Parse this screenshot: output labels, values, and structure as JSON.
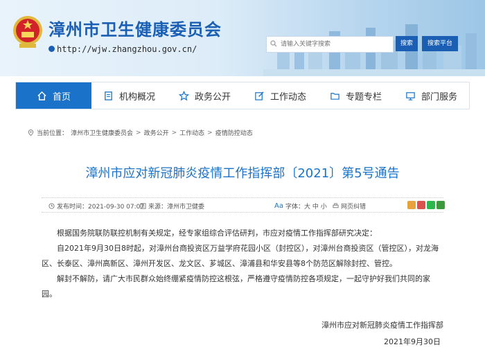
{
  "site": {
    "title": "漳州市卫生健康委员会",
    "url": "http://wjw.zhangzhou.gov.cn/"
  },
  "search": {
    "placeholder": "请输入关键字搜索",
    "search_label": "搜索",
    "platform_label": "搜索平台"
  },
  "nav": [
    {
      "label": "首页",
      "icon": "home-icon"
    },
    {
      "label": "机构概况",
      "icon": "document-icon"
    },
    {
      "label": "政务公开",
      "icon": "star-icon"
    },
    {
      "label": "工作动态",
      "icon": "edit-icon"
    },
    {
      "label": "专题专栏",
      "icon": "folder-icon"
    },
    {
      "label": "部门服务",
      "icon": "monitor-icon"
    }
  ],
  "breadcrumb": {
    "prefix": "当前位置：",
    "items": [
      "漳州市卫生健康委员会",
      "政务公开",
      "工作动态",
      "疫情防控动态"
    ]
  },
  "article": {
    "title": "漳州市应对新冠肺炎疫情工作指挥部〔2021〕第5号通告",
    "publish_time": "发布时间：2021-09-30 07:07",
    "source": "来源：漳州市卫健委",
    "font_size": "字体：大 中 小",
    "print": "网页纠错",
    "paragraphs": [
      "根据国务院联防联控机制有关规定，经专家组综合评估研判，市应对疫情工作指挥部研究决定：",
      "自2021年9月30日8时起，对漳州台商投资区万益学府花园小区（封控区），对漳州台商投资区（管控区），对龙海区、长泰区、漳州高新区、漳州开发区、龙文区、芗城区、漳浦县和华安县等8个防范区解除封控、管控。",
      "解封不解防，请广大市民群众始终绷紧疫情防控这根弦，严格遵守疫情防控各项规定，一起守护好我们共同的家园。"
    ],
    "signature": "漳州市应对新冠肺炎疫情工作指挥部",
    "date": "2021年9月30日"
  },
  "colors": {
    "brand": "#1a5fb4",
    "nav_active": "#1a73c8"
  }
}
